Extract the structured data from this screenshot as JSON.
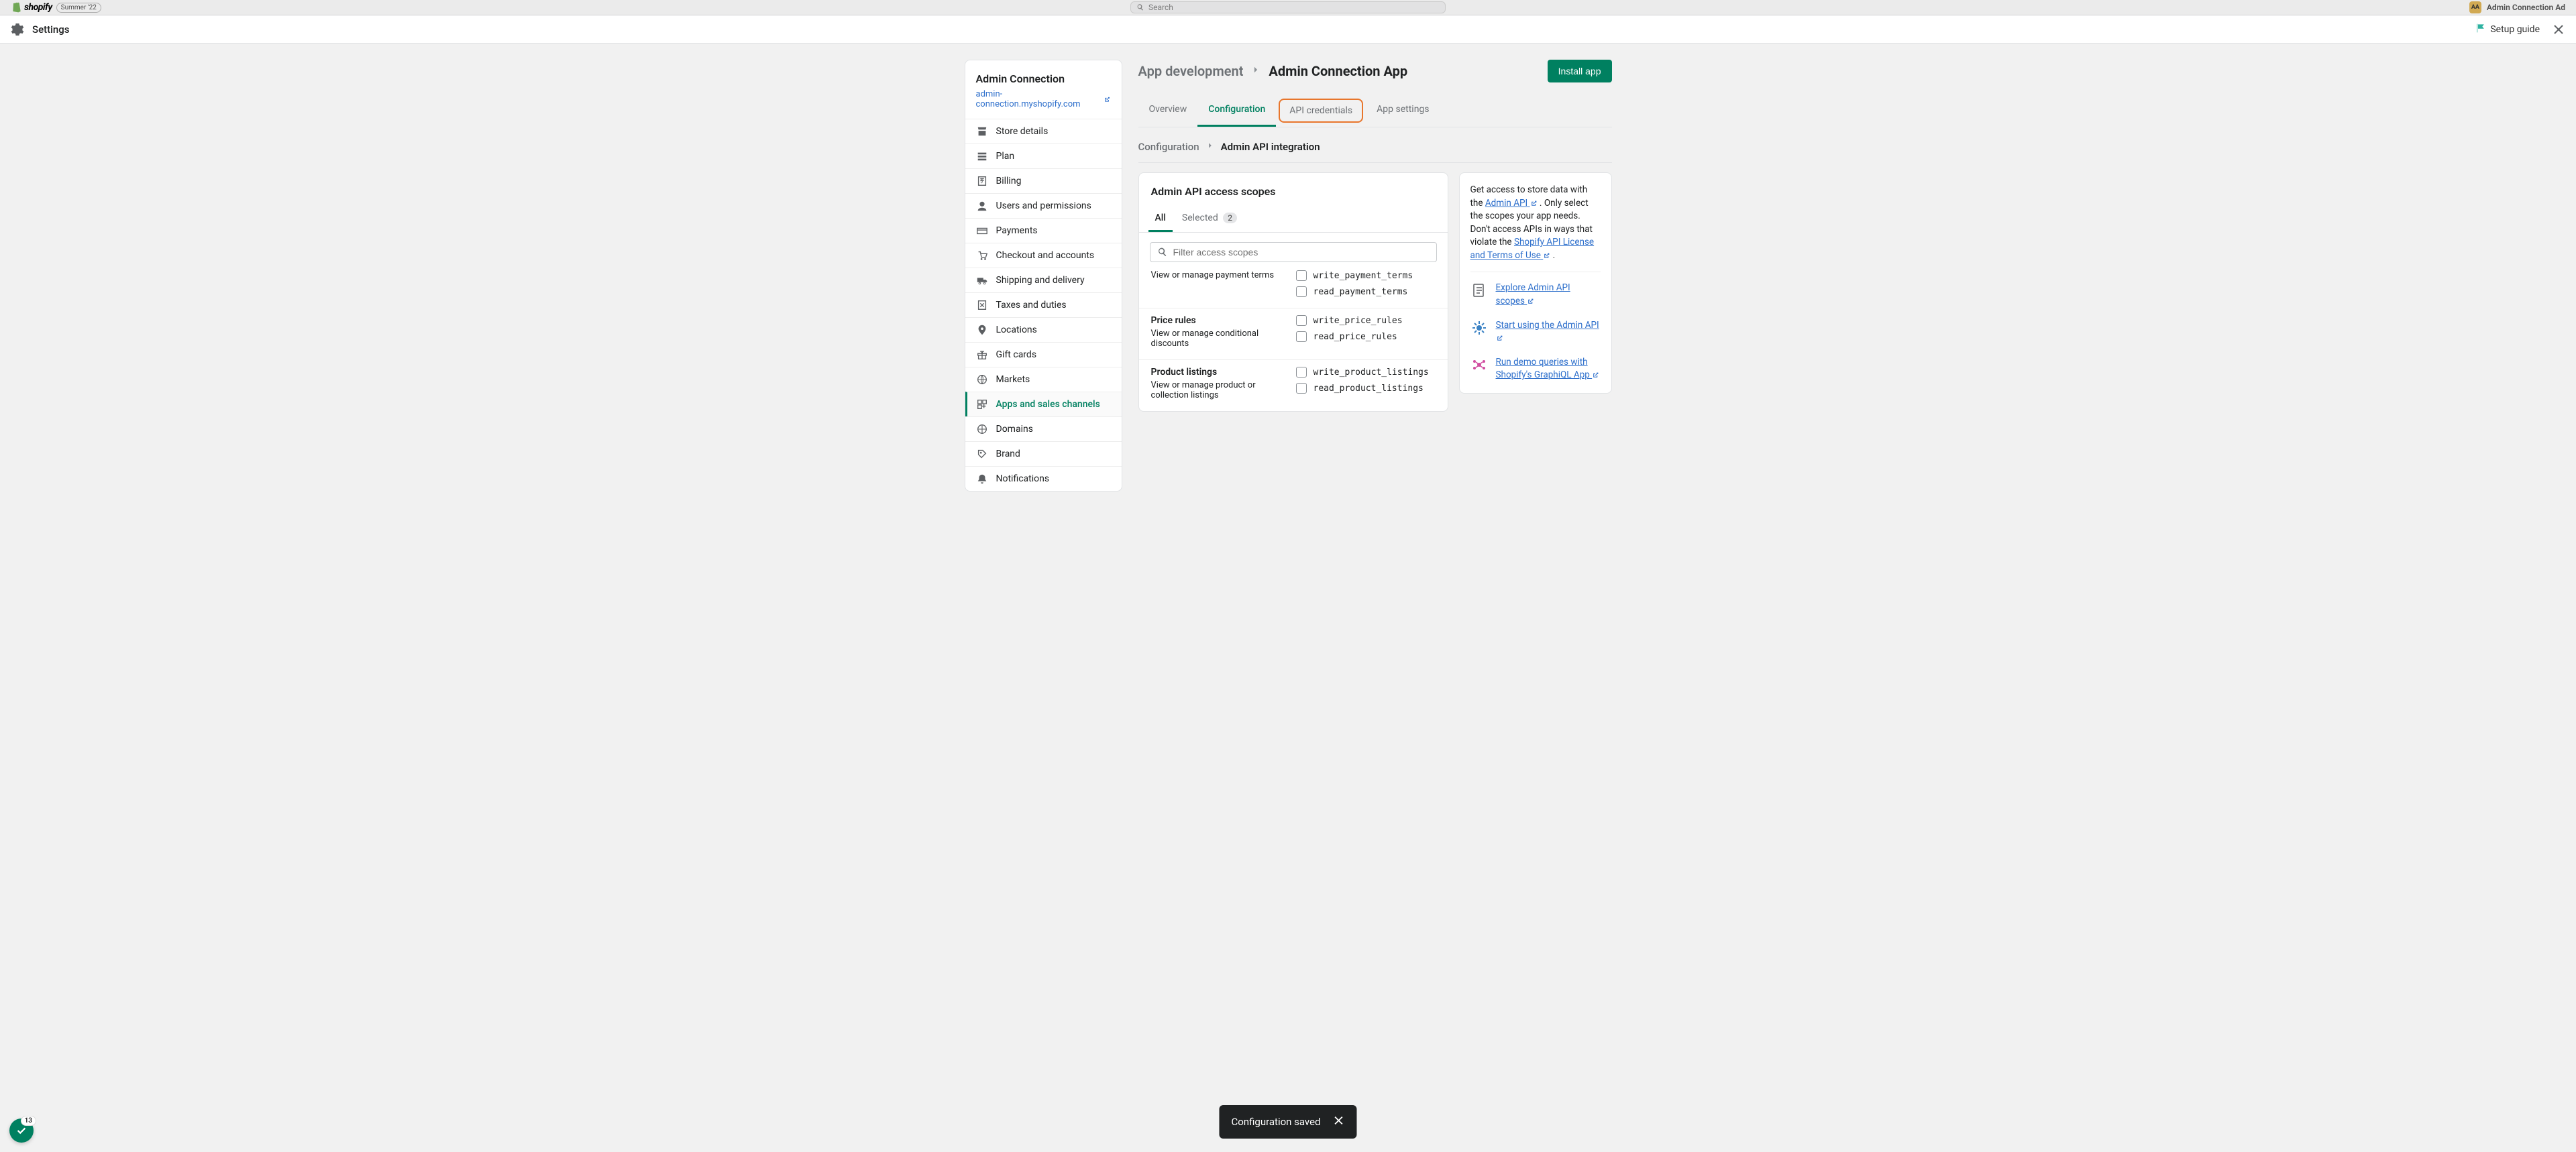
{
  "backdrop": {
    "logo": "shopify",
    "badge": "Summer '22",
    "search_placeholder": "Search",
    "user_initials": "AA",
    "user_name": "Admin Connection Ad"
  },
  "header": {
    "title": "Settings",
    "setup_guide": "Setup guide"
  },
  "sidebar": {
    "store_name": "Admin Connection",
    "store_url": "admin-connection.myshopify.com",
    "items": [
      {
        "label": "Store details",
        "icon": "store"
      },
      {
        "label": "Plan",
        "icon": "plan"
      },
      {
        "label": "Billing",
        "icon": "billing"
      },
      {
        "label": "Users and permissions",
        "icon": "users"
      },
      {
        "label": "Payments",
        "icon": "payments"
      },
      {
        "label": "Checkout and accounts",
        "icon": "checkout"
      },
      {
        "label": "Shipping and delivery",
        "icon": "shipping"
      },
      {
        "label": "Taxes and duties",
        "icon": "taxes"
      },
      {
        "label": "Locations",
        "icon": "locations"
      },
      {
        "label": "Gift cards",
        "icon": "gift"
      },
      {
        "label": "Markets",
        "icon": "markets"
      },
      {
        "label": "Apps and sales channels",
        "icon": "apps",
        "active": true
      },
      {
        "label": "Domains",
        "icon": "domains"
      },
      {
        "label": "Brand",
        "icon": "brand"
      },
      {
        "label": "Notifications",
        "icon": "notifications"
      }
    ]
  },
  "main": {
    "crumb_parent": "App development",
    "crumb_current": "Admin Connection App",
    "install_button": "Install app",
    "tabs": [
      {
        "label": "Overview"
      },
      {
        "label": "Configuration",
        "active": true
      },
      {
        "label": "API credentials",
        "highlight": true
      },
      {
        "label": "App settings"
      }
    ],
    "sub_crumb_parent": "Configuration",
    "sub_crumb_current": "Admin API integration",
    "scopes_card_title": "Admin API access scopes",
    "scope_tabs": {
      "all": "All",
      "selected": "Selected",
      "selected_count": "2"
    },
    "filter_placeholder": "Filter access scopes",
    "scope_sections": [
      {
        "title": "",
        "desc": "View or manage payment terms",
        "checks": [
          "write_payment_terms",
          "read_payment_terms"
        ]
      },
      {
        "title": "Price rules",
        "desc": "View or manage conditional discounts",
        "checks": [
          "write_price_rules",
          "read_price_rules"
        ]
      },
      {
        "title": "Product listings",
        "desc": "View or manage product or collection listings",
        "checks": [
          "write_product_listings",
          "read_product_listings"
        ]
      }
    ]
  },
  "info_panel": {
    "lead": "Get access to store data with the ",
    "admin_api_link": "Admin API",
    "mid": " . Only select the scopes your app needs. Don't access APIs in ways that violate the ",
    "license_link": "Shopify API License and Terms of Use",
    "tail": " .",
    "links": [
      {
        "label": "Explore Admin API scopes"
      },
      {
        "label": "Start using the Admin API"
      },
      {
        "label": "Run demo queries with Shopify's GraphiQL App"
      }
    ]
  },
  "toast": {
    "message": "Configuration saved"
  },
  "fab": {
    "count": "13"
  }
}
